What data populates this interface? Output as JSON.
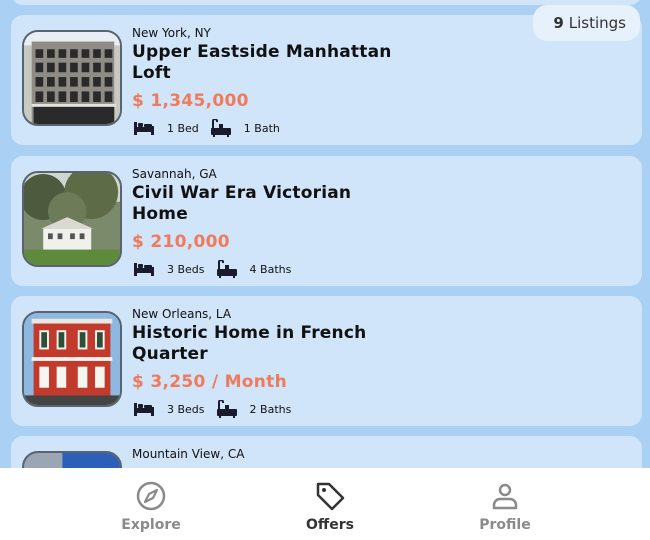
{
  "listings_badge": {
    "count": "9",
    "label": "Listings"
  },
  "listings": [
    {
      "location": "New York, NY",
      "title": "Upper Eastside Manhattan Loft",
      "price": "$ 1,345,000",
      "beds": "1 Bed",
      "baths": "1 Bath"
    },
    {
      "location": "Savannah, GA",
      "title": "Civil War Era Victorian Home",
      "price": "$ 210,000",
      "beds": "3 Beds",
      "baths": "4 Baths"
    },
    {
      "location": "New Orleans, LA",
      "title": "Historic Home in French Quarter",
      "price": "$ 3,250 / Month",
      "beds": "3 Beds",
      "baths": "2 Baths"
    },
    {
      "location": "Mountain View, CA"
    }
  ],
  "tabs": [
    {
      "label": "Explore",
      "icon": "compass-icon",
      "active": false
    },
    {
      "label": "Offers",
      "icon": "tag-icon",
      "active": true
    },
    {
      "label": "Profile",
      "icon": "person-icon",
      "active": false
    }
  ],
  "colors": {
    "background": "#aad0f4",
    "card": "#d0e5fa",
    "price": "#f07a5a",
    "tab_active": "#333333",
    "tab_inactive": "#8a8a8a"
  }
}
